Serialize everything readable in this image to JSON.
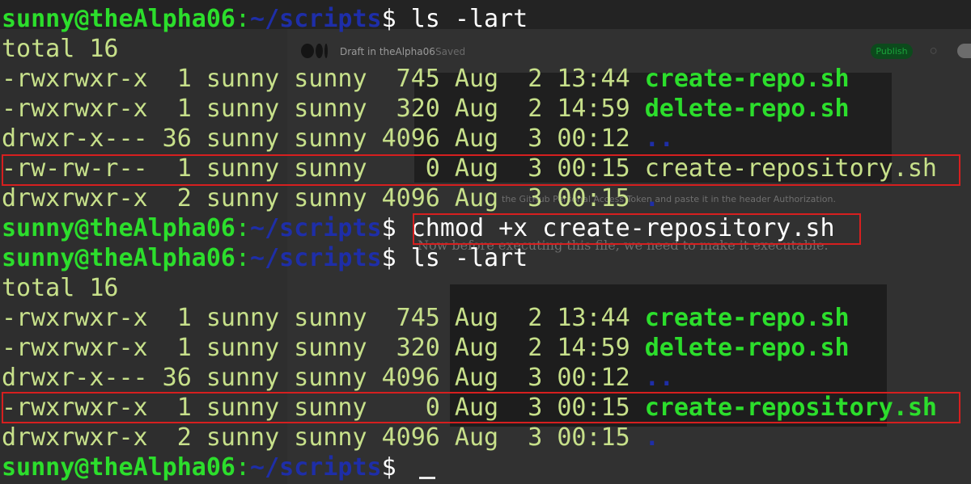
{
  "background": {
    "draft_label": "Draft in theAlpha06",
    "saved_label": "Saved",
    "publish_label": "Publish",
    "paragraph_1": "the GitHub Personal Access Token and paste it in the header Authorization.",
    "paragraph_2": "Now before executing this file, we need to make it executable."
  },
  "terminal": {
    "prompt_user": "sunny@theAlpha06",
    "prompt_colon": ":",
    "prompt_path": "~/scripts",
    "prompt_dollar": "$",
    "lines": [
      {
        "perm": "-rwxrwxr-x",
        "links": "1",
        "owner": "sunny",
        "group": "sunny",
        "size": "745",
        "month": "Aug",
        "day": "2",
        "time": "13:44",
        "name": "create-repo.sh"
      },
      {
        "perm": "-rwxrwxr-x",
        "links": "1",
        "owner": "sunny",
        "group": "sunny",
        "size": "320",
        "month": "Aug",
        "day": "2",
        "time": "14:59",
        "name": "delete-repo.sh"
      },
      {
        "perm": "drwxr-x---",
        "links": "36",
        "owner": "sunny",
        "group": "sunny",
        "size": "4096",
        "month": "Aug",
        "day": "3",
        "time": "00:12",
        "name": ".."
      },
      {
        "perm": "-rw-rw-r--",
        "links": "1",
        "owner": "sunny",
        "group": "sunny",
        "size": "0",
        "month": "Aug",
        "day": "3",
        "time": "00:15",
        "name": "create-repository.sh"
      },
      {
        "perm": "drwxrwxr-x",
        "links": "2",
        "owner": "sunny",
        "group": "sunny",
        "size": "4096",
        "month": "Aug",
        "day": "3",
        "time": "00:15",
        "name": "."
      }
    ],
    "lines2": [
      {
        "perm": "-rwxrwxr-x",
        "links": "1",
        "owner": "sunny",
        "group": "sunny",
        "size": "745",
        "month": "Aug",
        "day": "2",
        "time": "13:44",
        "name": "create-repo.sh"
      },
      {
        "perm": "-rwxrwxr-x",
        "links": "1",
        "owner": "sunny",
        "group": "sunny",
        "size": "320",
        "month": "Aug",
        "day": "2",
        "time": "14:59",
        "name": "delete-repo.sh"
      },
      {
        "perm": "drwxr-x---",
        "links": "36",
        "owner": "sunny",
        "group": "sunny",
        "size": "4096",
        "month": "Aug",
        "day": "3",
        "time": "00:12",
        "name": ".."
      },
      {
        "perm": "-rwxrwxr-x",
        "links": "1",
        "owner": "sunny",
        "group": "sunny",
        "size": "0",
        "month": "Aug",
        "day": "3",
        "time": "00:15",
        "name": "create-repository.sh"
      },
      {
        "perm": "drwxrwxr-x",
        "links": "2",
        "owner": "sunny",
        "group": "sunny",
        "size": "4096",
        "month": "Aug",
        "day": "3",
        "time": "00:15",
        "name": "."
      }
    ],
    "cmd_ls": "ls -lart",
    "cmd_chmod": "chmod +x create-repository.sh",
    "total": "total 16",
    "row1_text": "-rwxrwxr-x  1 sunny sunny  745 Aug  2 13:44 ",
    "row2_text": "-rwxrwxr-x  1 sunny sunny  320 Aug  2 14:59 ",
    "row3_text": "drwxr-x--- 36 sunny sunny 4096 Aug  3 00:12 ",
    "row4_text": "-rw-rw-r--  1 sunny sunny    0 Aug  3 00:15 ",
    "row5_text": "drwxrwxr-x  2 sunny sunny 4096 Aug  3 00:15 ",
    "row9_text": "-rwxrwxr-x  1 sunny sunny    0 Aug  3 00:15 ",
    "highlight_color": "#d61f1f"
  }
}
